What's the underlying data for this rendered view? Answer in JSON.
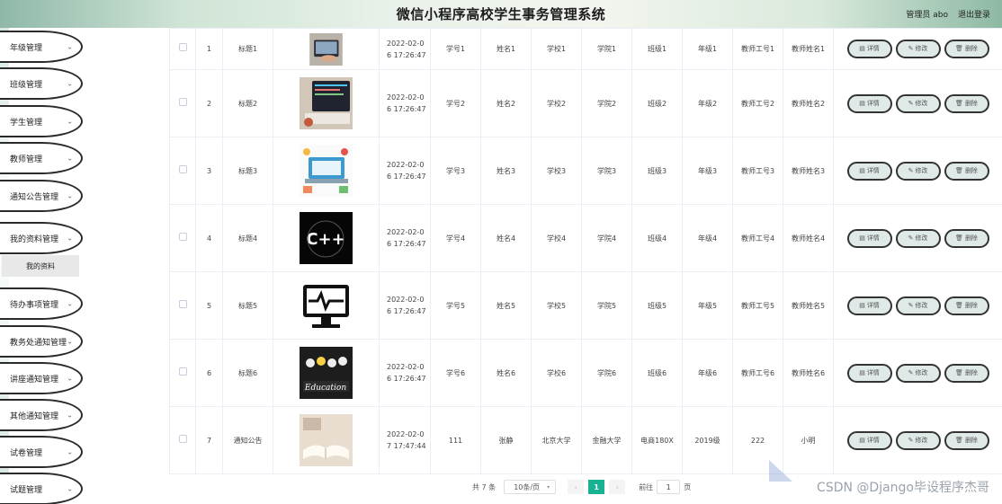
{
  "header": {
    "title": "微信小程序高校学生事务管理系统",
    "user": "管理员 abo",
    "logout": "退出登录"
  },
  "sidebar": {
    "items": [
      {
        "label": "年级管理"
      },
      {
        "label": "班级管理"
      },
      {
        "label": "学生管理"
      },
      {
        "label": "教师管理"
      },
      {
        "label": "通知公告管理"
      },
      {
        "label": "我的资料管理"
      },
      {
        "label": "待办事项管理"
      },
      {
        "label": "教务处通知管理"
      },
      {
        "label": "讲座通知管理"
      },
      {
        "label": "其他通知管理"
      },
      {
        "label": "试卷管理"
      },
      {
        "label": "试题管理"
      }
    ],
    "sub_item": "我的资料"
  },
  "table": {
    "rows": [
      {
        "idx": "1",
        "title": "标题1",
        "date": "2022-02-0\n6 17:26:47",
        "xuehao": "学号1",
        "name": "姓名1",
        "school": "学校1",
        "college": "学院1",
        "cls": "班级1",
        "grade": "年级1",
        "tid": "教师工号1",
        "tname": "教师姓名1",
        "image": "laptop-typing"
      },
      {
        "idx": "2",
        "title": "标题2",
        "date": "2022-02-0\n6 17:26:47",
        "xuehao": "学号2",
        "name": "姓名2",
        "school": "学校2",
        "college": "学院2",
        "cls": "班级2",
        "grade": "年级2",
        "tid": "教师工号2",
        "tname": "教师姓名2",
        "image": "laptop-code"
      },
      {
        "idx": "3",
        "title": "标题3",
        "date": "2022-02-0\n6 17:26:47",
        "xuehao": "学号3",
        "name": "姓名3",
        "school": "学校3",
        "college": "学院3",
        "cls": "班级3",
        "grade": "年级3",
        "tid": "教师工号3",
        "tname": "教师姓名3",
        "image": "laptop-illustration"
      },
      {
        "idx": "4",
        "title": "标题4",
        "date": "2022-02-0\n6 17:26:47",
        "xuehao": "学号4",
        "name": "姓名4",
        "school": "学校4",
        "college": "学院4",
        "cls": "班级4",
        "grade": "年级4",
        "tid": "教师工号4",
        "tname": "教师姓名4",
        "image": "cpp-logo"
      },
      {
        "idx": "5",
        "title": "标题5",
        "date": "2022-02-0\n6 17:26:47",
        "xuehao": "学号5",
        "name": "姓名5",
        "school": "学校5",
        "college": "学院5",
        "cls": "班级5",
        "grade": "年级5",
        "tid": "教师工号5",
        "tname": "教师姓名5",
        "image": "monitor-pulse"
      },
      {
        "idx": "6",
        "title": "标题6",
        "date": "2022-02-0\n6 17:26:47",
        "xuehao": "学号6",
        "name": "姓名6",
        "school": "学校6",
        "college": "学院6",
        "cls": "班级6",
        "grade": "年级6",
        "tid": "教师工号6",
        "tname": "教师姓名6",
        "image": "education-chalkboard"
      },
      {
        "idx": "7",
        "title": "通知公告",
        "date": "2022-02-0\n7 17:47:44",
        "xuehao": "111",
        "name": "张静",
        "school": "北京大学",
        "college": "金融大学",
        "cls": "电商180X",
        "grade": "2019级",
        "tid": "222",
        "tname": "小明",
        "image": "open-book"
      }
    ],
    "buttons": {
      "detail": "详情",
      "edit": "修改",
      "delete": "删除"
    }
  },
  "pagination": {
    "total": "共 7 条",
    "page_size": "10条/页",
    "current_page": "1",
    "goto_prefix": "前往",
    "goto_value": "1",
    "goto_suffix": "页",
    "prev_icon": "chevron-left-icon",
    "next_icon": "chevron-right-icon"
  },
  "watermark": "CSDN @Django毕设程序杰哥",
  "colors": {
    "accent": "#19b394",
    "button_bg": "#dfe9e7"
  }
}
